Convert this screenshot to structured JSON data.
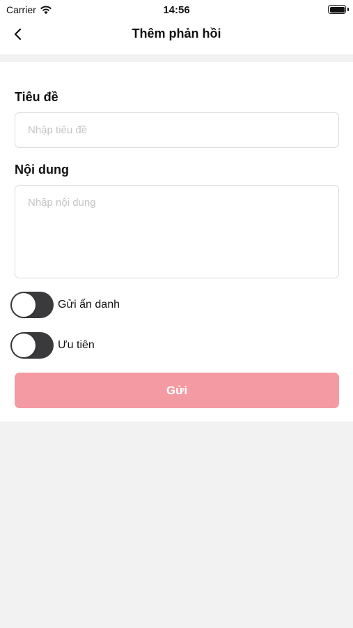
{
  "status_bar": {
    "carrier": "Carrier",
    "time": "14:56",
    "wifi_icon": "wifi-icon",
    "battery_icon": "battery-icon"
  },
  "nav": {
    "title": "Thêm phản hồi",
    "back_icon": "chevron-left-icon"
  },
  "form": {
    "title_label": "Tiêu đề",
    "title_value": "",
    "title_placeholder": "Nhập tiêu đề",
    "content_label": "Nội dung",
    "content_value": "",
    "content_placeholder": "Nhập nội dung",
    "toggles": [
      {
        "label": "Gửi ẩn danh",
        "on": false
      },
      {
        "label": "Ưu tiên",
        "on": false
      }
    ],
    "submit_label": "Gửi"
  },
  "colors": {
    "accent": "#f49aa2",
    "toggle_off": "#3a3a3c",
    "background": "#f2f2f2"
  }
}
